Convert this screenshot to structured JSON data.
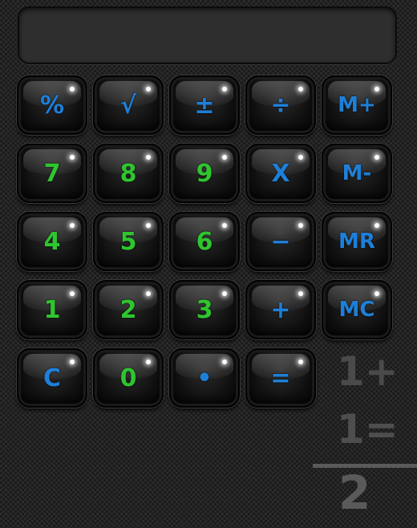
{
  "display": {
    "value": ""
  },
  "keypad": {
    "rows": [
      [
        {
          "name": "percent-button",
          "label": "%",
          "color": "blue"
        },
        {
          "name": "sqrt-button",
          "label": "√",
          "color": "blue"
        },
        {
          "name": "plus-minus-button",
          "label": "±",
          "color": "blue"
        },
        {
          "name": "divide-button",
          "label": "÷",
          "color": "blue"
        },
        {
          "name": "memory-add-button",
          "label": "M+",
          "color": "blue"
        }
      ],
      [
        {
          "name": "digit-7-button",
          "label": "7",
          "color": "green"
        },
        {
          "name": "digit-8-button",
          "label": "8",
          "color": "green"
        },
        {
          "name": "digit-9-button",
          "label": "9",
          "color": "green"
        },
        {
          "name": "multiply-button",
          "label": "X",
          "color": "blue"
        },
        {
          "name": "memory-subtract-button",
          "label": "M-",
          "color": "blue"
        }
      ],
      [
        {
          "name": "digit-4-button",
          "label": "4",
          "color": "green"
        },
        {
          "name": "digit-5-button",
          "label": "5",
          "color": "green"
        },
        {
          "name": "digit-6-button",
          "label": "6",
          "color": "green"
        },
        {
          "name": "subtract-button",
          "label": "−",
          "color": "blue"
        },
        {
          "name": "memory-recall-button",
          "label": "MR",
          "color": "blue"
        }
      ],
      [
        {
          "name": "digit-1-button",
          "label": "1",
          "color": "green"
        },
        {
          "name": "digit-2-button",
          "label": "2",
          "color": "green"
        },
        {
          "name": "digit-3-button",
          "label": "3",
          "color": "green"
        },
        {
          "name": "add-button",
          "label": "+",
          "color": "blue"
        },
        {
          "name": "memory-clear-button",
          "label": "MC",
          "color": "blue"
        }
      ],
      [
        {
          "name": "clear-button",
          "label": "C",
          "color": "blue"
        },
        {
          "name": "digit-0-button",
          "label": "0",
          "color": "green"
        },
        {
          "name": "decimal-button",
          "label": "•",
          "color": "blue"
        },
        {
          "name": "equals-button",
          "label": "=",
          "color": "blue"
        }
      ]
    ]
  },
  "history": {
    "line1": "1+",
    "line2": "1=",
    "result": "2"
  },
  "colors": {
    "blue": "#1e7fd8",
    "green": "#2ec62e"
  }
}
